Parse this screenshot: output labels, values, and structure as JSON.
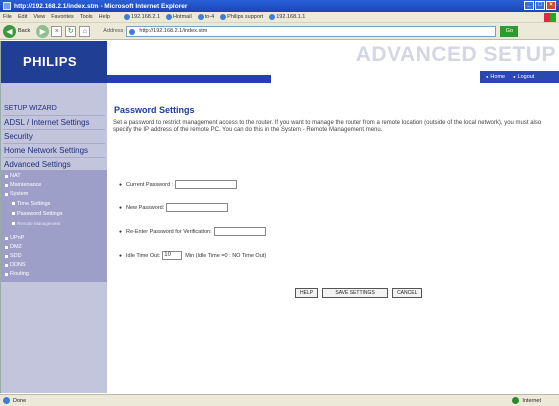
{
  "window": {
    "title": "http://192.168.2.1/index.stm - Microsoft Internet Explorer",
    "controls": [
      "_",
      "□",
      "×"
    ]
  },
  "menu": {
    "items": [
      "File",
      "Edit",
      "View",
      "Favorites",
      "Tools",
      "Help"
    ],
    "links": [
      "192.168.2.1",
      "Hotmail",
      "to-4",
      "Philips support",
      "192.168.1.1"
    ]
  },
  "toolbar": {
    "back_label": "Back",
    "address_label": "Address",
    "address_value": "http://192.168.2.1/index.stm",
    "go_label": "Go"
  },
  "brand": {
    "logo": "PHILIPS",
    "banner": "ADVANCED SETUP",
    "home_link": "Home",
    "logout_link": "Logout"
  },
  "sidebar": {
    "setup_wizard": "SETUP WIZARD",
    "adsl_internet": "ADSL / Internet Settings",
    "security": "Security",
    "home_network": "Home Network Settings",
    "advanced": "Advanced Settings",
    "items": {
      "nat": "NAT",
      "maintenance": "Maintenance",
      "system": "System",
      "time_settings": "Time Settings",
      "password_settings": "Password Settings",
      "remote_management": "Remote Management",
      "upnp": "UPnP",
      "dmz": "DMZ",
      "sdd": "SDD",
      "ddns": "DDNS",
      "routing": "Routing"
    }
  },
  "main": {
    "heading": "Password Settings",
    "description": "Set a password to restrict management access to the router. If you want to manage the router from a remote location (outside of the local network), you must also specify the IP address of the remote PC. You can do this in the System - Remote Management menu.",
    "current_password_label": "Current Password :",
    "new_password_label": "New Password:",
    "reenter_label": "Re-Enter Password for Verification:",
    "idle_label": "Idle Time Out:",
    "idle_value": "10",
    "idle_suffix": "Min (Idle Time =0 : NO Time Out)",
    "help_button": "HELP",
    "save_button": "SAVE SETTINGS",
    "cancel_button": "CANCEL"
  },
  "status": {
    "left": "Done",
    "zone": "Internet"
  }
}
